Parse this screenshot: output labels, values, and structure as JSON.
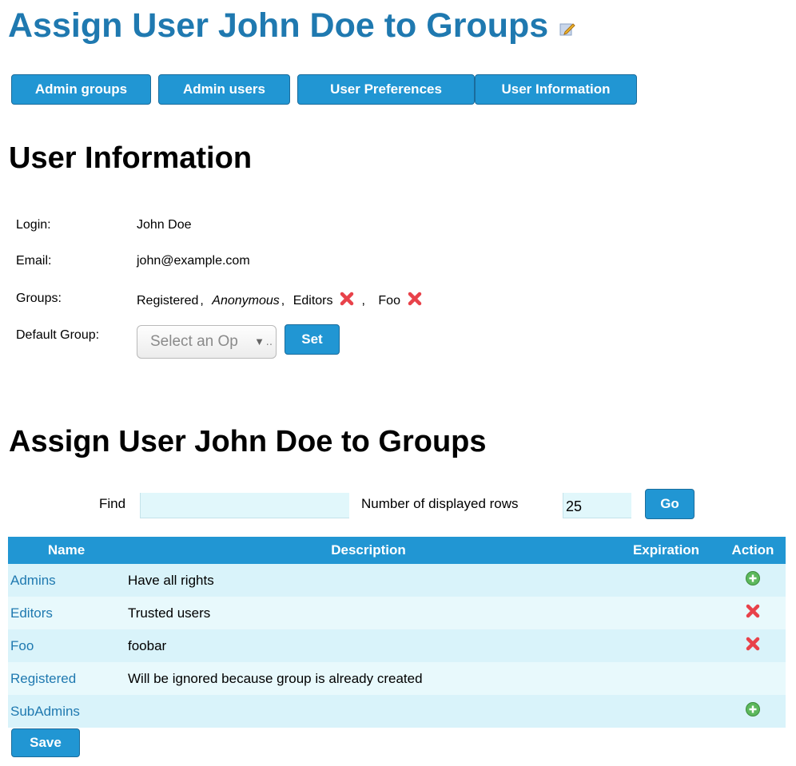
{
  "page": {
    "title": "Assign User John Doe to Groups"
  },
  "nav": [
    {
      "label": "Admin groups"
    },
    {
      "label": "Admin users"
    },
    {
      "label": "User Preferences"
    },
    {
      "label": "User Information"
    }
  ],
  "user_info": {
    "heading": "User Information",
    "login_label": "Login:",
    "login_value": "John Doe",
    "email_label": "Email:",
    "email_value": "john@example.com",
    "groups_label": "Groups:",
    "groups": [
      {
        "name": "Registered",
        "removable": false,
        "italic": false
      },
      {
        "name": "Anonymous",
        "removable": false,
        "italic": true
      },
      {
        "name": "Editors",
        "removable": true,
        "italic": false
      },
      {
        "name": "Foo",
        "removable": true,
        "italic": false
      }
    ],
    "separator": ",",
    "default_group_label": "Default Group:",
    "default_group_placeholder": "Select an Op",
    "select_ellipsis": "..",
    "set_label": "Set"
  },
  "assign": {
    "heading": "Assign User John Doe to Groups",
    "find_label": "Find",
    "find_value": "",
    "rows_label": "Number of displayed rows",
    "rows_value": "25",
    "go_label": "Go",
    "columns": [
      "Name",
      "Description",
      "Expiration",
      "Action"
    ],
    "rows": [
      {
        "name": "Admins",
        "description": "Have all rights",
        "expiration": "",
        "action": "add"
      },
      {
        "name": "Editors",
        "description": "Trusted users",
        "expiration": "",
        "action": "remove"
      },
      {
        "name": "Foo",
        "description": "foobar",
        "expiration": "",
        "action": "remove"
      },
      {
        "name": "Registered",
        "description": "Will be ignored because group is already created",
        "expiration": "",
        "action": "none"
      },
      {
        "name": "SubAdmins",
        "description": "",
        "expiration": "",
        "action": "add"
      }
    ],
    "save_label": "Save"
  },
  "colors": {
    "accent": "#2196d3",
    "title": "#1f79b0",
    "row_odd": "#d9f3fa",
    "row_even": "#e8f9fc",
    "remove": "#e8424a",
    "add": "#5cb85c"
  }
}
